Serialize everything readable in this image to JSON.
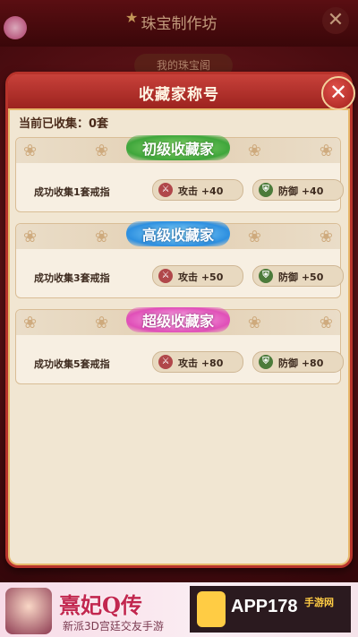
{
  "background": {
    "title": "珠宝制作坊",
    "subtab": "我的珠宝阁"
  },
  "dialog": {
    "title": "收藏家称号",
    "close_icon": "✕",
    "collected_label": "当前已收集：0套",
    "tiers": [
      {
        "badge": "初级收藏家",
        "requirement": "成功收集1套戒指",
        "attack": "攻击 +40",
        "defense": "防御 +40",
        "color": "#3fa63b"
      },
      {
        "badge": "高级收藏家",
        "requirement": "成功收集3套戒指",
        "attack": "攻击 +50",
        "defense": "防御 +50",
        "color": "#2d8fe0"
      },
      {
        "badge": "超级收藏家",
        "requirement": "成功收集5套戒指",
        "attack": "攻击 +80",
        "defense": "防御 +80",
        "color": "#e04fb8"
      }
    ]
  },
  "ad": {
    "game_logo": "熹妃Q传",
    "tagline": "新派3D宫廷交友手游",
    "brand": "APP178",
    "brand_sub": "手游网"
  },
  "icons": {
    "attack_icon": "sword-icon",
    "defense_icon": "shield-icon"
  }
}
